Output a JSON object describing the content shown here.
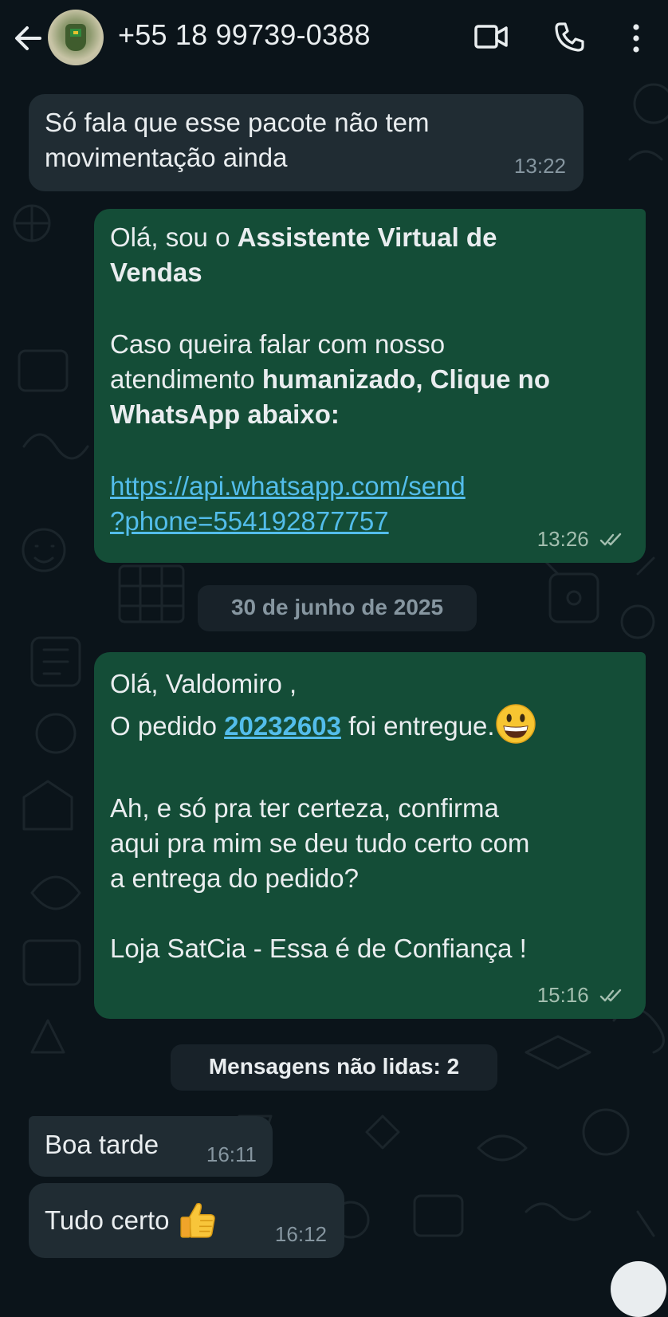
{
  "header": {
    "contact_name": "+55 18 99739-0388"
  },
  "messages": [
    {
      "direction": "incoming",
      "lines": [
        "Só fala que esse pacote não tem",
        "movimentação ainda"
      ],
      "time": "13:22"
    },
    {
      "direction": "outgoing",
      "line1_a": "Olá, sou o ",
      "line1_b": "Assistente Virtual de",
      "line2": "Vendas",
      "line3": "Caso queira falar com nosso",
      "line4_a": "atendimento ",
      "line4_b": "humanizado, Clique no",
      "line5": "WhatsApp abaixo:",
      "link_line1": "https://api.whatsapp.com/send",
      "link_line2": "?phone=554192877757",
      "time": "13:26",
      "status": "read"
    },
    {
      "direction": "outgoing",
      "line1": "Olá, Valdomiro ,",
      "line2_a": "O pedido ",
      "line2_link": "20232603",
      "line2_b": " foi entregue.",
      "line2_emoji": "grinning-face",
      "line3": "Ah, e só pra ter certeza, confirma",
      "line4": "aqui pra mim se deu tudo certo com",
      "line5": "a entrega do pedido?",
      "line6": "Loja SatCia - Essa é de Confiança !",
      "time": "15:16",
      "status": "read"
    },
    {
      "direction": "incoming",
      "text": "Boa tarde",
      "time": "16:11"
    },
    {
      "direction": "incoming",
      "text": "Tudo certo",
      "emoji": "thumbs-up",
      "time": "16:12"
    }
  ],
  "date_separator": "30 de junho de 2025",
  "unread_separator": "Mensagens não lidas: 2",
  "colors": {
    "background": "#0b141a",
    "incoming_bubble": "#202c33",
    "outgoing_bubble": "#144d37",
    "link": "#53bdeb",
    "timestamp": "#8696a0"
  }
}
